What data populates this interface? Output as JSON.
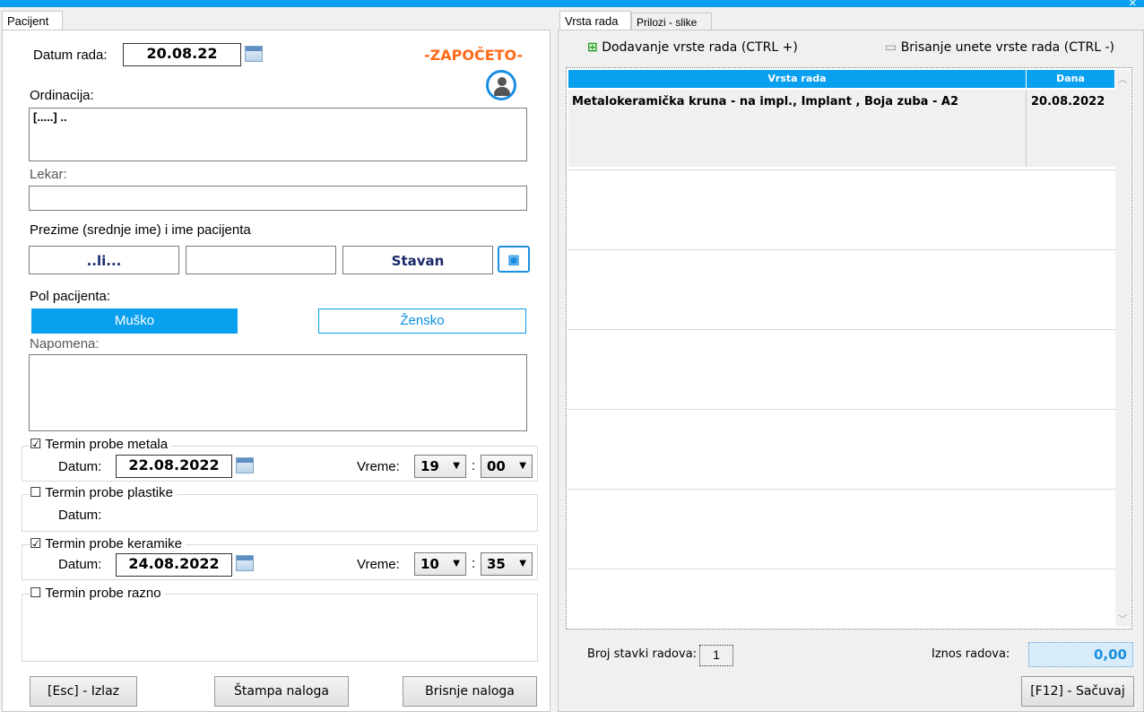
{
  "window": {
    "close_glyph": "✕"
  },
  "left_tabs": {
    "pacijent": "Pacijent"
  },
  "right_tabs": {
    "vrsta_rada": "Vrsta rada",
    "prilozi": "Prilozi - slike"
  },
  "patient": {
    "datum_rada_label": "Datum rada:",
    "datum_rada_value": "20.08.22",
    "status": "-ZAPOČETO-",
    "ordinacija_label": "Ordinacija:",
    "ordinacija_value": "[.....] ..",
    "lekar_label": "Lekar:",
    "lekar_value": "",
    "name_label": "Prezime (srednje ime) i ime pacijenta",
    "prezime": "..li...",
    "srednje_ime": "",
    "ime": "Stavan",
    "pol_label": "Pol pacijenta:",
    "musko": "Muško",
    "zensko": "Žensko",
    "napomena_label": "Napomena:",
    "napomena_value": ""
  },
  "termini": {
    "metal": {
      "title": "Termin probe metala",
      "checked": "☑",
      "datum_label": "Datum:",
      "datum": "22.08.2022",
      "vreme_label": "Vreme:",
      "hour": "19",
      "minute": "00",
      "colon": ":"
    },
    "plastika": {
      "title": "Termin probe plastike",
      "checked": "☐",
      "datum_label": "Datum:"
    },
    "keramika": {
      "title": "Termin probe keramike",
      "checked": "☑",
      "datum_label": "Datum:",
      "datum": "24.08.2022",
      "vreme_label": "Vreme:",
      "hour": "10",
      "minute": "35",
      "colon": ":"
    },
    "razno": {
      "title": "Termin probe razno",
      "checked": "☐"
    }
  },
  "left_buttons": {
    "izlaz": "[Esc] - Izlaz",
    "stampa": "Štampa naloga",
    "brisanje": "Brisnje naloga"
  },
  "work": {
    "add_label": "Dodavanje vrste rada (CTRL +)",
    "delete_label": "Brisanje unete vrste rada (CTRL -)",
    "columns": {
      "vrsta": "Vrsta rada",
      "dana": "Dana"
    },
    "rows": [
      {
        "vrsta": "Metalokeramička kruna - na impl., Implant , Boja zuba - A2",
        "dana": "20.08.2022"
      }
    ],
    "broj_label": "Broj stavki radova:",
    "broj_value": "1",
    "iznos_label": "Iznos radova:",
    "iznos_value": "0,00",
    "save": "[F12] - Sačuvaj"
  },
  "icons": {
    "calendar": "calendar-icon",
    "sync_user": "sync-user-icon",
    "id_card": "id-card-icon",
    "add": "add-document-icon",
    "delete": "delete-document-icon",
    "dropdown": "chevron-down-icon"
  }
}
